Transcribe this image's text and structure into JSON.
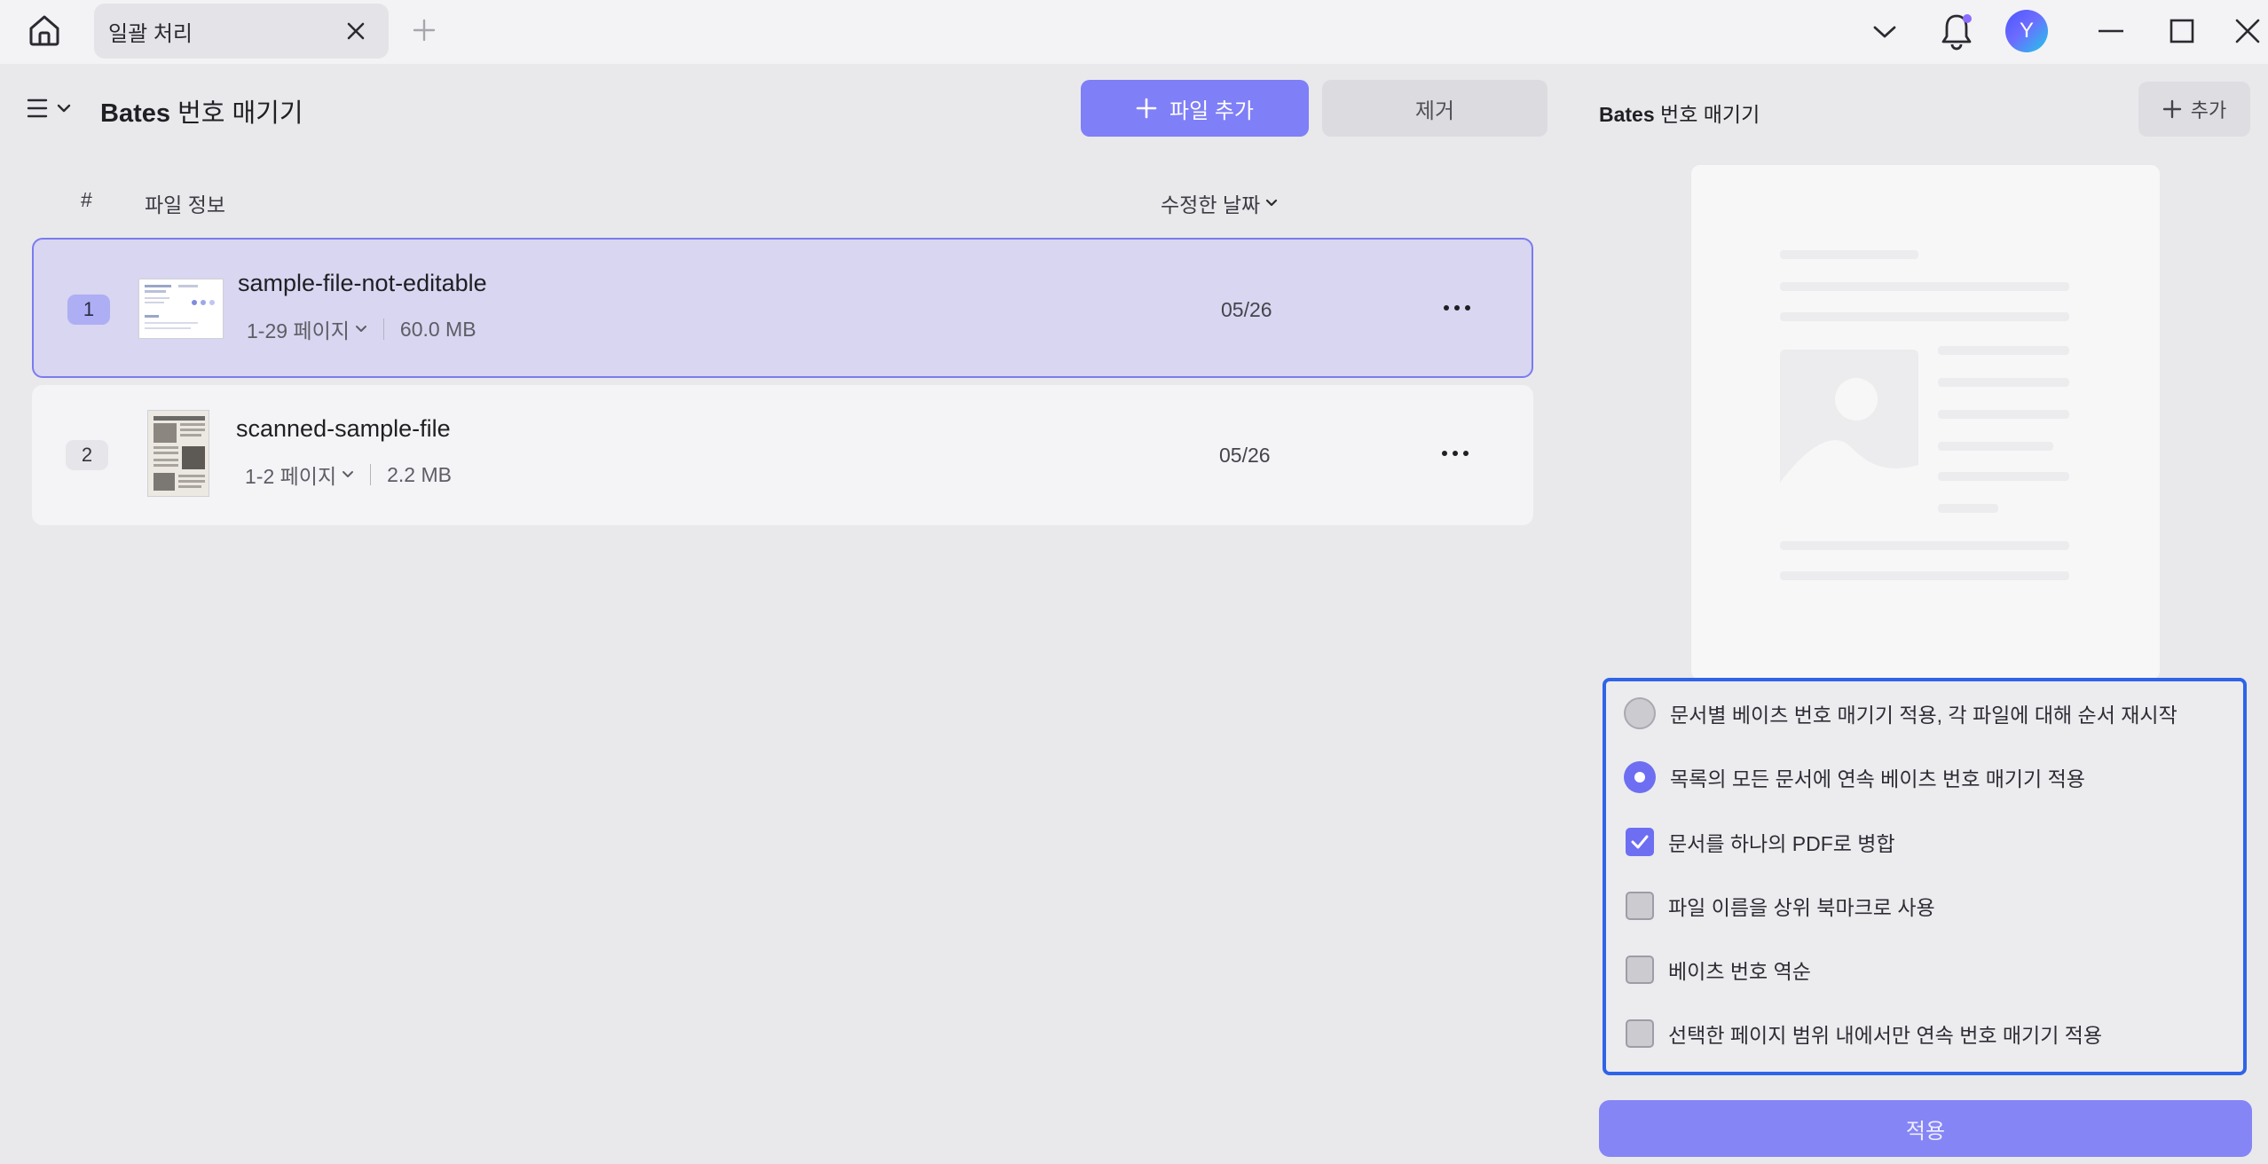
{
  "titlebar": {
    "tab_title": "일괄 처리",
    "avatar_initial": "Y"
  },
  "left": {
    "title_bold": "Bates",
    "title_rest": " 번호 매기기",
    "add_file_label": "파일 추가",
    "remove_label": "제거",
    "columns": {
      "number": "#",
      "info": "파일 정보",
      "date": "수정한 날짜"
    },
    "files": [
      {
        "index": "1",
        "name": "sample-file-not-editable",
        "pages": "1-29 페이지",
        "size": "60.0 MB",
        "date": "05/26",
        "selected": true
      },
      {
        "index": "2",
        "name": "scanned-sample-file",
        "pages": "1-2 페이지",
        "size": "2.2 MB",
        "date": "05/26",
        "selected": false
      }
    ]
  },
  "right": {
    "title_bold": "Bates",
    "title_rest": " 번호 매기기",
    "add_label": "추가",
    "options": [
      {
        "type": "radio",
        "label": "문서별 베이츠 번호 매기기 적용, 각 파일에 대해 순서 재시작",
        "checked": false
      },
      {
        "type": "radio",
        "label": "목록의 모든 문서에 연속 베이츠 번호 매기기 적용",
        "checked": true
      },
      {
        "type": "checkbox",
        "label": "문서를 하나의 PDF로 병합",
        "checked": true
      },
      {
        "type": "checkbox",
        "label": "파일 이름을 상위 북마크로 사용",
        "checked": false
      },
      {
        "type": "checkbox",
        "label": "베이츠 번호 역순",
        "checked": false
      },
      {
        "type": "checkbox",
        "label": "선택한 페이지 범위 내에서만 연속 번호 매기기 적용",
        "checked": false
      }
    ],
    "apply_label": "적용"
  },
  "colors": {
    "accent": "#7f7ff7",
    "selected_row": "#d8d6f0",
    "focus_border": "#2f64e8"
  },
  "icons": [
    "home-icon",
    "close-icon",
    "plus-icon",
    "chevron-down-icon",
    "bell-icon",
    "minimize-icon",
    "maximize-icon",
    "menu-icon",
    "more-icon",
    "check-icon"
  ]
}
